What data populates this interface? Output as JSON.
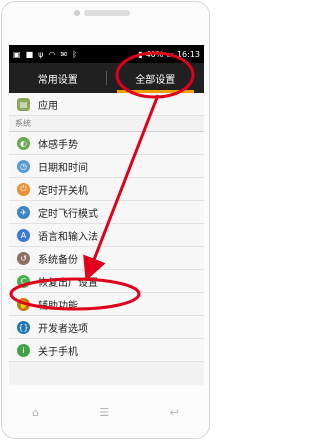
{
  "status_bar": {
    "left_icons": [
      "sim-icon",
      "notification-icon",
      "usb-icon",
      "wifi-icon",
      "email-icon",
      "bluetooth-icon"
    ],
    "battery": "40%",
    "time": "16:13"
  },
  "tabs": [
    {
      "label": "常用设置"
    },
    {
      "label": "全部设置"
    }
  ],
  "top_item": {
    "label": "应用",
    "icon": "apps-icon",
    "color": "#8aa85a"
  },
  "section_label": "系统",
  "settings": [
    {
      "label": "体感手势",
      "icon": "gesture-icon",
      "color": "#6aa84f",
      "glyph": "◐"
    },
    {
      "label": "日期和时间",
      "icon": "clock-icon",
      "color": "#5b9bd5",
      "glyph": "◷"
    },
    {
      "label": "定时开关机",
      "icon": "power-icon",
      "color": "#e69138",
      "glyph": "⏻"
    },
    {
      "label": "定时飞行模式",
      "icon": "airplane-icon",
      "color": "#3d85c6",
      "glyph": "✈"
    },
    {
      "label": "语言和输入法",
      "icon": "language-icon",
      "color": "#3c78d8",
      "glyph": "A"
    },
    {
      "label": "系统备份",
      "icon": "backup-icon",
      "color": "#8d6e63",
      "glyph": "↺"
    },
    {
      "label": "恢复出厂设置",
      "icon": "reset-icon",
      "color": "#4caf50",
      "glyph": "C"
    },
    {
      "label": "辅助功能",
      "icon": "accessibility-icon",
      "color": "#c27c0e",
      "glyph": "✋"
    },
    {
      "label": "开发者选项",
      "icon": "developer-icon",
      "color": "#1f78b4",
      "glyph": "{}"
    },
    {
      "label": "关于手机",
      "icon": "info-icon",
      "color": "#43a047",
      "glyph": "i"
    }
  ],
  "annotation_color": "#e0001b"
}
